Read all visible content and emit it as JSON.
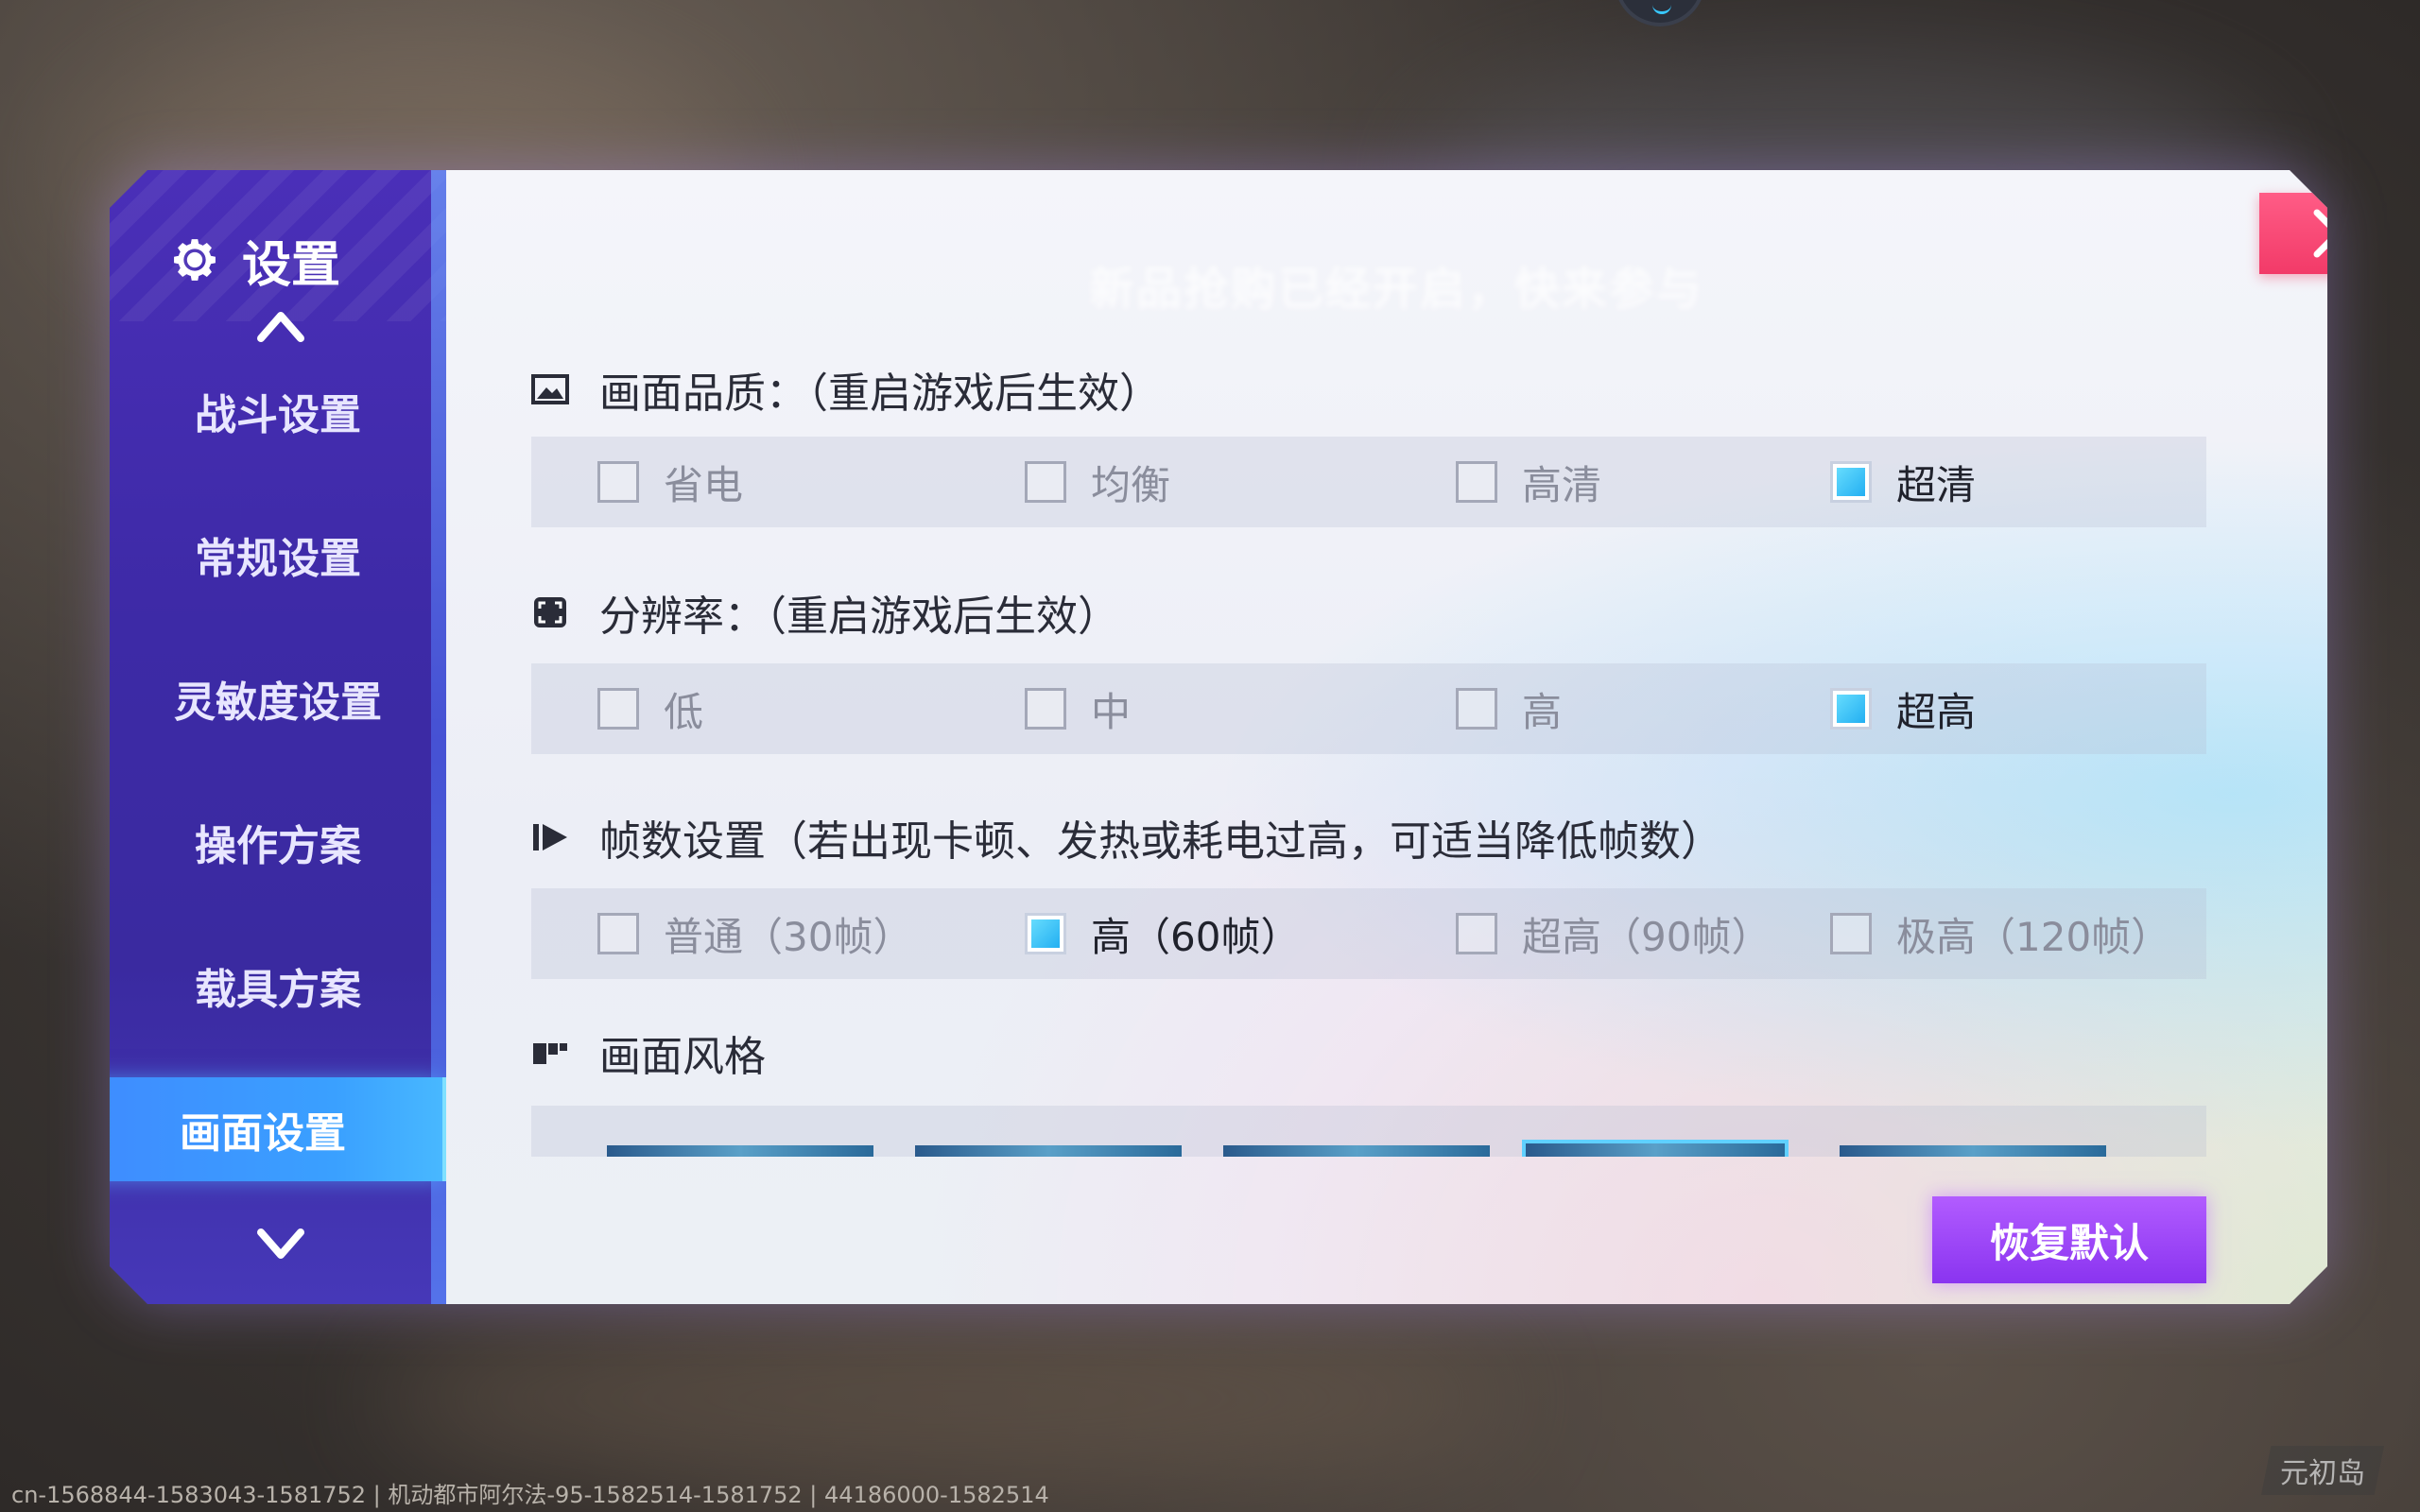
{
  "sidebar": {
    "title": "设置",
    "items": [
      {
        "label": "战斗设置"
      },
      {
        "label": "常规设置"
      },
      {
        "label": "灵敏度设置"
      },
      {
        "label": "操作方案"
      },
      {
        "label": "载具方案"
      },
      {
        "label": "画面设置"
      }
    ]
  },
  "header": {
    "ghost_title": "新品抢购已经开启，快来参与"
  },
  "sections": {
    "quality": {
      "title": "画面品质：（重启游戏后生效）",
      "options": [
        "省电",
        "均衡",
        "高清",
        "超清"
      ],
      "selected": "超清"
    },
    "resolution": {
      "title": "分辨率：（重启游戏后生效）",
      "options": [
        "低",
        "中",
        "高",
        "超高"
      ],
      "selected": "超高"
    },
    "framerate": {
      "title": "帧数设置（若出现卡顿、发热或耗电过高，可适当降低帧数）",
      "options": [
        "普通（30帧）",
        "高（60帧）",
        "超高（90帧）",
        "极高（120帧）"
      ],
      "selected": "高（60帧）"
    },
    "style": {
      "title": "画面风格",
      "selected_index": 3
    }
  },
  "buttons": {
    "reset": "恢复默认"
  },
  "footer": {
    "id_text": "cn-1568844-1583043-1581752 | 机动都市阿尔法-95-1582514-1581752 | 44186000-1582514",
    "watermark": "元初岛"
  },
  "colors": {
    "accent_blue": "#3aa0ff",
    "close_red": "#f23a68",
    "reset_purple": "#8a34f0",
    "sidebar_purple": "#3d2aa6"
  }
}
